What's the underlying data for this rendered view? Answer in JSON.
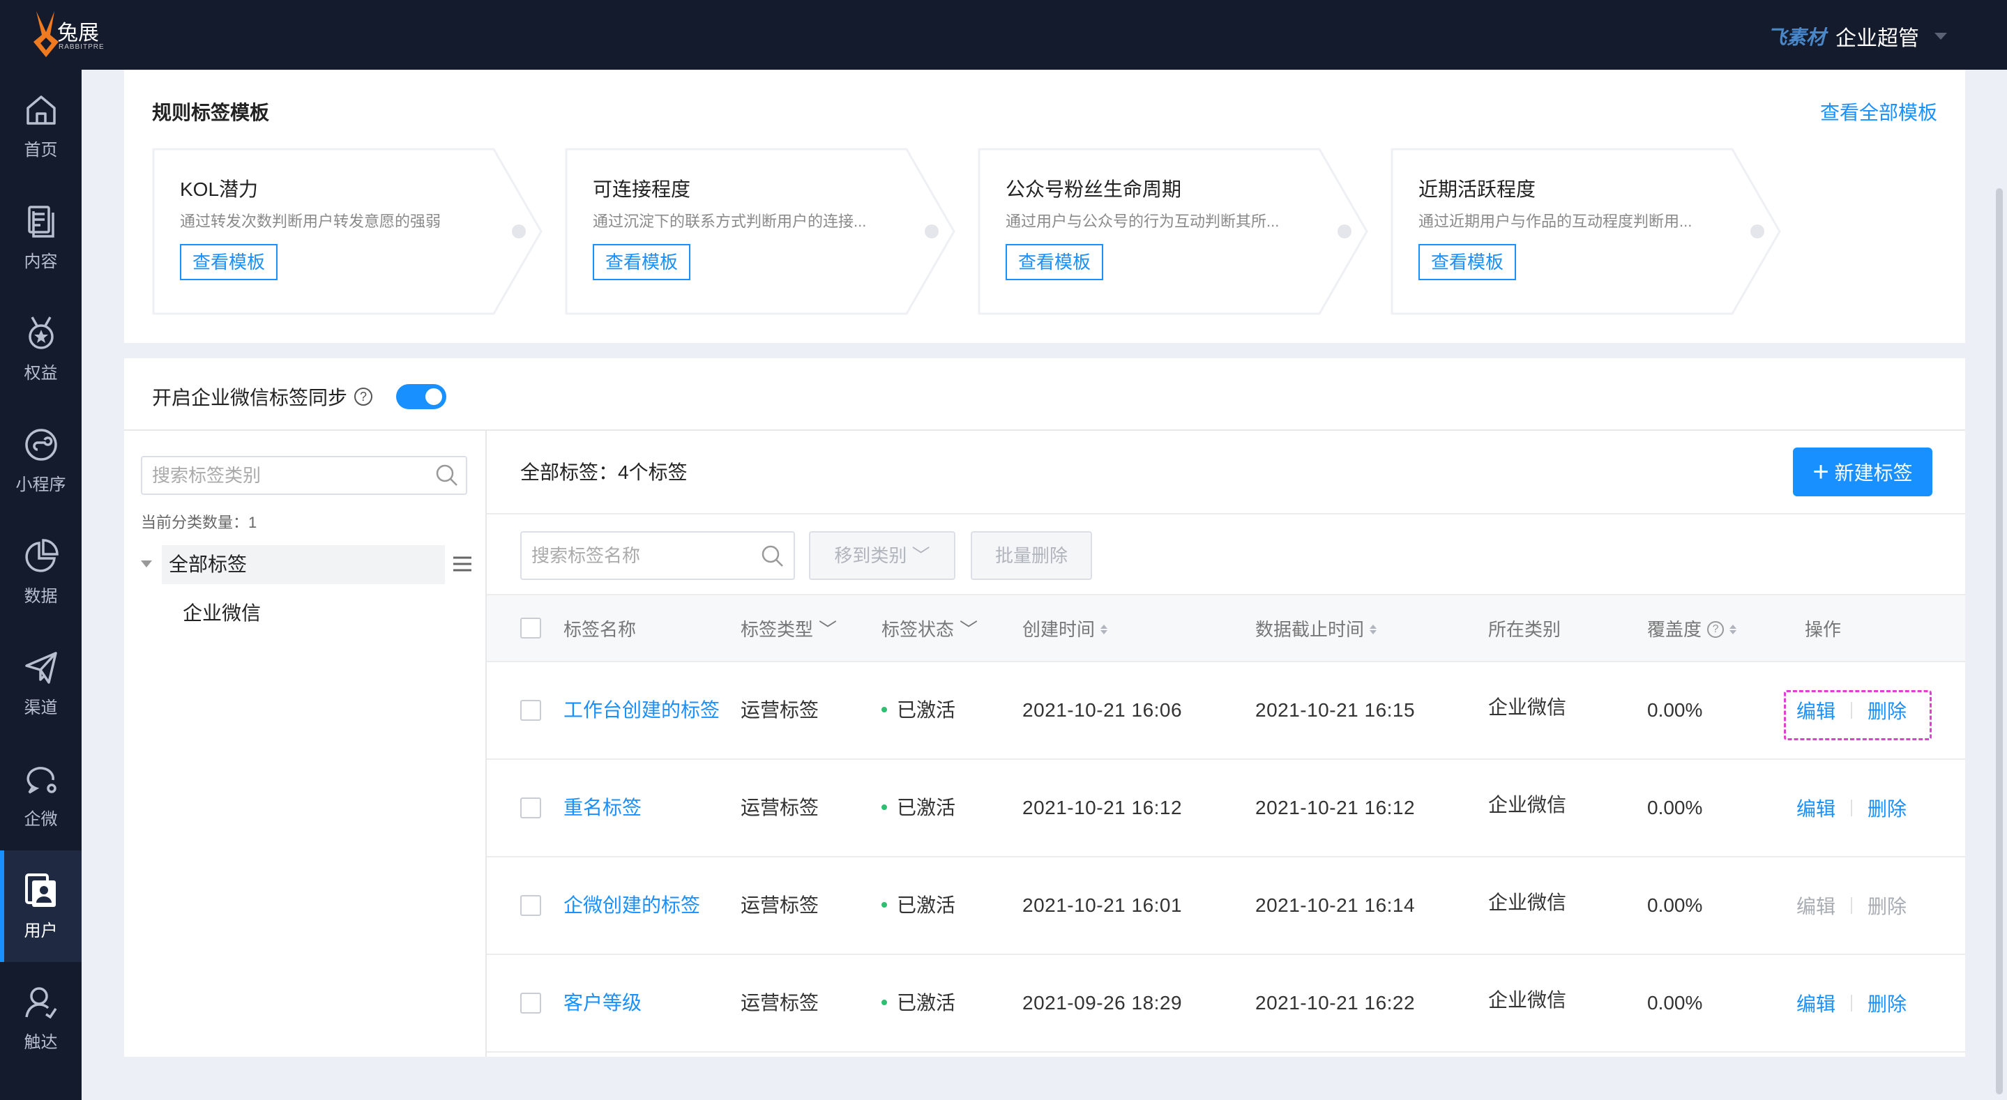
{
  "header": {
    "logo_text": "兔展",
    "logo_sub": "RABBITPRE",
    "user_brand": "飞素材",
    "user_role": "企业超管"
  },
  "sidebar": {
    "items": [
      {
        "label": "首页",
        "icon": "home-icon"
      },
      {
        "label": "内容",
        "icon": "document-icon"
      },
      {
        "label": "权益",
        "icon": "medal-icon"
      },
      {
        "label": "小程序",
        "icon": "mini-program-icon"
      },
      {
        "label": "数据",
        "icon": "pie-chart-icon"
      },
      {
        "label": "渠道",
        "icon": "paper-plane-icon"
      },
      {
        "label": "企微",
        "icon": "chat-icon"
      },
      {
        "label": "用户",
        "icon": "user-card-icon",
        "active": true
      },
      {
        "label": "触达",
        "icon": "user-reach-icon"
      }
    ]
  },
  "templates": {
    "title": "规则标签模板",
    "view_all": "查看全部模板",
    "button_label": "查看模板",
    "cards": [
      {
        "title": "KOL潜力",
        "desc": "通过转发次数判断用户转发意愿的强弱"
      },
      {
        "title": "可连接程度",
        "desc": "通过沉淀下的联系方式判断用户的连接..."
      },
      {
        "title": "公众号粉丝生命周期",
        "desc": "通过用户与公众号的行为互动判断其所..."
      },
      {
        "title": "近期活跃程度",
        "desc": "通过近期用户与作品的互动程度判断用..."
      }
    ]
  },
  "sync": {
    "label": "开启企业微信标签同步",
    "help": "?",
    "enabled": true
  },
  "categories": {
    "search_placeholder": "搜索标签类别",
    "count_text": "当前分类数量：1",
    "root": "全部标签",
    "children": [
      "企业微信"
    ]
  },
  "tags": {
    "summary": "全部标签：4个标签",
    "new_button": "新建标签",
    "search_placeholder": "搜索标签名称",
    "move_button": "移到类别",
    "batch_delete_button": "批量删除",
    "columns": {
      "name": "标签名称",
      "type": "标签类型",
      "status": "标签状态",
      "created": "创建时间",
      "deadline": "数据截止时间",
      "category": "所在类别",
      "coverage": "覆盖度",
      "actions": "操作"
    },
    "edit_label": "编辑",
    "delete_label": "删除",
    "rows": [
      {
        "name": "工作台创建的标签",
        "type": "运营标签",
        "status": "已激活",
        "created": "2021-10-21 16:06",
        "deadline": "2021-10-21 16:15",
        "category": "企业微信",
        "coverage": "0.00%",
        "actions_enabled": true
      },
      {
        "name": "重名标签",
        "type": "运营标签",
        "status": "已激活",
        "created": "2021-10-21 16:12",
        "deadline": "2021-10-21 16:12",
        "category": "企业微信",
        "coverage": "0.00%",
        "actions_enabled": true
      },
      {
        "name": "企微创建的标签",
        "type": "运营标签",
        "status": "已激活",
        "created": "2021-10-21 16:01",
        "deadline": "2021-10-21 16:14",
        "category": "企业微信",
        "coverage": "0.00%",
        "actions_enabled": false
      },
      {
        "name": "客户等级",
        "type": "运营标签",
        "status": "已激活",
        "created": "2021-09-26 18:29",
        "deadline": "2021-10-21 16:22",
        "category": "企业微信",
        "coverage": "0.00%",
        "actions_enabled": true
      }
    ]
  },
  "colors": {
    "accent": "#1890ff",
    "sidebar_bg": "#141b2d",
    "status_active": "#2fbf71",
    "focus_outline": "#e23fd0"
  }
}
